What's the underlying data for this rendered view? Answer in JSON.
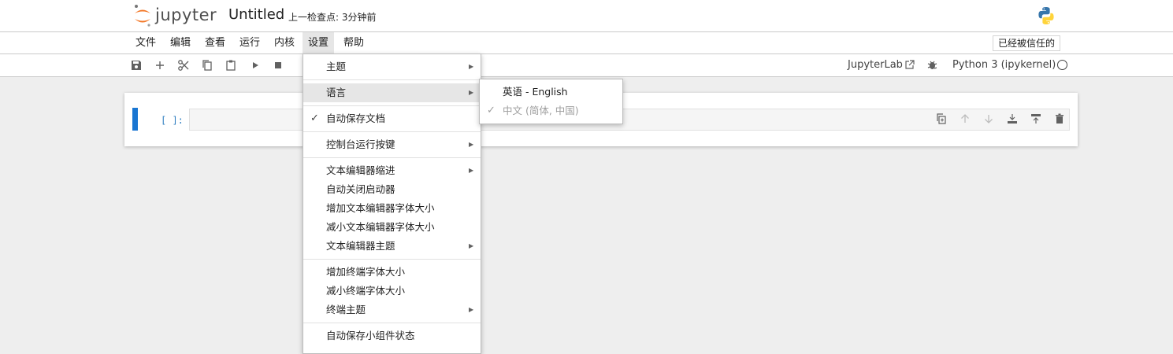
{
  "header": {
    "logo_text": "jupyter",
    "notebook_title": "Untitled",
    "checkpoint": "上一检查点: 3分钟前"
  },
  "menubar": {
    "items": [
      "文件",
      "编辑",
      "查看",
      "运行",
      "内核",
      "设置",
      "帮助"
    ],
    "trusted_label": "已经被信任的"
  },
  "toolbar": {
    "icons": [
      "save-icon",
      "add-icon",
      "cut-icon",
      "copy-icon",
      "paste-icon",
      "run-icon",
      "stop-icon"
    ],
    "jupyterlab_label": "JupyterLab",
    "kernel_label": "Python 3 (ipykernel)"
  },
  "cell": {
    "prompt": "[ ]:"
  },
  "settings_menu": {
    "items": [
      {
        "label": "主题",
        "submenu": true
      },
      {
        "label": "语言",
        "submenu": true,
        "active": true
      },
      {
        "label": "自动保存文档",
        "checked": true
      },
      {
        "label": "控制台运行按键",
        "submenu": true
      },
      {
        "label": "文本编辑器缩进",
        "submenu": true
      },
      {
        "label": "自动关闭启动器"
      },
      {
        "label": "增加文本编辑器字体大小"
      },
      {
        "label": "减小文本编辑器字体大小"
      },
      {
        "label": "文本编辑器主题",
        "submenu": true
      },
      {
        "label": "增加终端字体大小"
      },
      {
        "label": "减小终端字体大小"
      },
      {
        "label": "终端主题",
        "submenu": true
      },
      {
        "label": "自动保存小组件状态"
      }
    ]
  },
  "language_submenu": {
    "items": [
      {
        "label": "英语 - English"
      },
      {
        "label": "中文 (简体, 中国)",
        "checked": true,
        "disabled": true
      }
    ]
  },
  "colors": {
    "accent": "#1976d2",
    "jupyter_orange": "#f37726",
    "menu_active_bg": "#e6e6e6"
  }
}
